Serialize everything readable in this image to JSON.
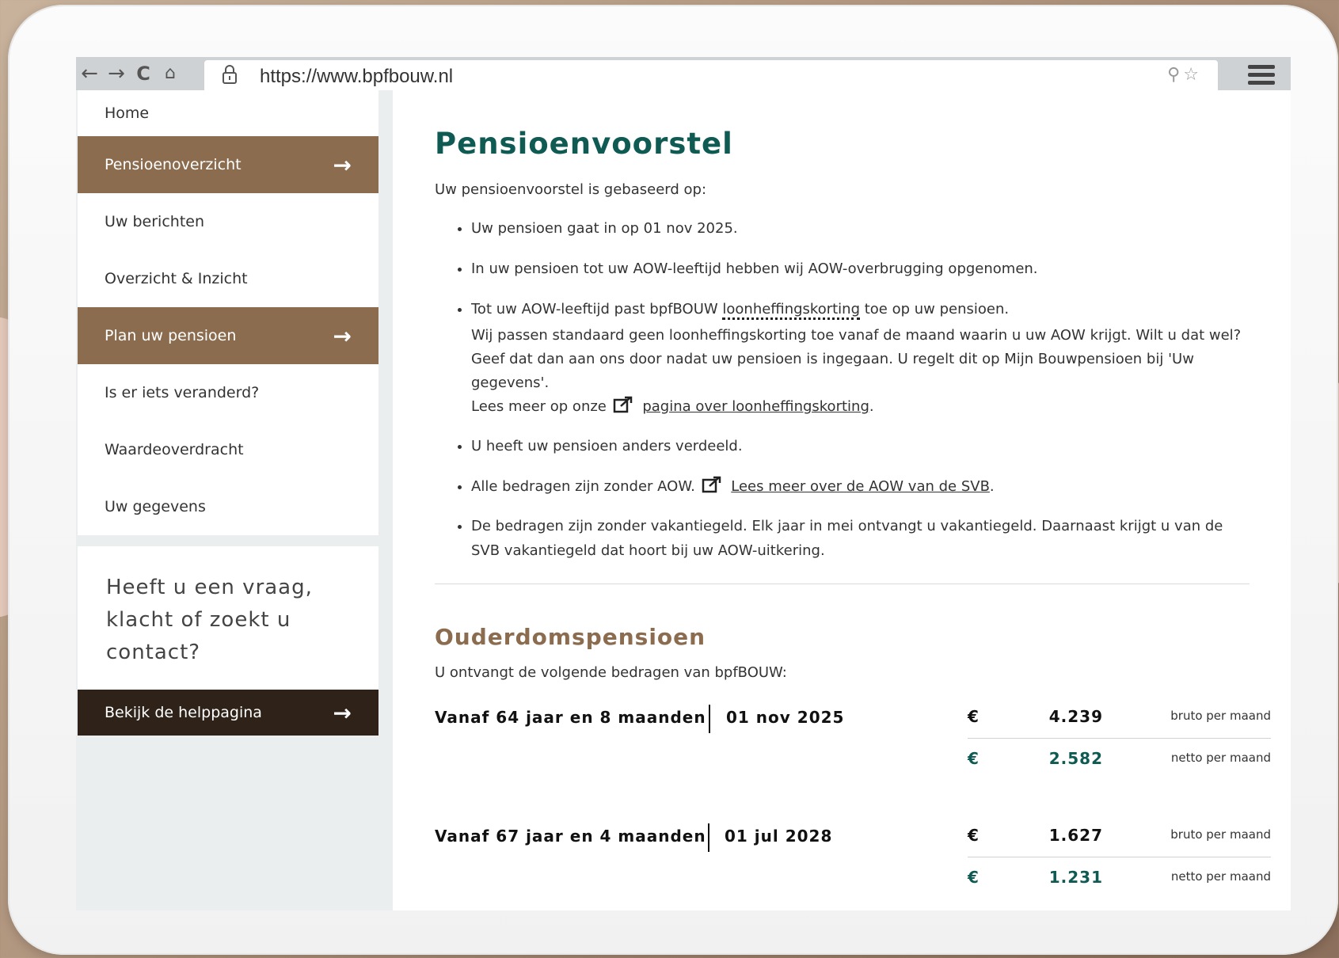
{
  "browser": {
    "url": "https://www.bpfbouw.nl"
  },
  "sidebar": {
    "items": [
      {
        "label": "Home"
      },
      {
        "label": "Pensioenoverzicht"
      },
      {
        "label": "Uw berichten"
      },
      {
        "label": "Overzicht & Inzicht"
      },
      {
        "label": "Plan uw pensioen"
      },
      {
        "label": "Is er iets veranderd?"
      },
      {
        "label": "Waardeoverdracht"
      },
      {
        "label": "Uw gegevens"
      }
    ],
    "help_text": "Heeft u een vraag, klacht of zoekt u contact?",
    "help_button": "Bekijk de helppagina"
  },
  "main": {
    "title": "Pensioenvoorstel",
    "intro": "Uw pensioenvoorstel is gebaseerd op:",
    "bullet1": "Uw pensioen gaat in op 01 nov 2025.",
    "bullet2": "In uw pensioen tot uw AOW-leeftijd hebben wij AOW-overbrugging opgenomen.",
    "bullet3_a": "Tot uw AOW-leeftijd past bpfBOUW ",
    "bullet3_term": "loonheffingskorting",
    "bullet3_b": " toe op uw pensioen.",
    "bullet3_para": "Wij passen standaard geen loonheffingskorting toe vanaf de maand waarin u uw AOW krijgt. Wilt u dat wel? Geef dat dan aan ons door nadat uw pensioen is ingegaan. U regelt dit op Mijn Bouwpensioen bij 'Uw gegevens'.",
    "bullet3_read": "Lees meer op onze",
    "bullet3_link": "pagina over loonheffingskorting",
    "bullet4": "U heeft uw pensioen anders verdeeld.",
    "bullet5_a": "Alle bedragen zijn zonder AOW.",
    "bullet5_link": "Lees meer over de AOW van de SVB",
    "bullet6": "De bedragen zijn zonder vakantiegeld. Elk jaar in mei ontvangt u vakantiegeld. Daarnaast krijgt u van de SVB vakantiegeld dat hoort bij uw AOW-uitkering.",
    "section_title": "Ouderdomspensioen",
    "section_intro": "U ontvangt de volgende bedragen van bpfBOUW:"
  },
  "amounts": [
    {
      "period": "Vanaf 64 jaar en 8 maanden",
      "date": "01 nov 2025",
      "currency": "€",
      "gross": "4.239",
      "gross_label": "bruto per maand",
      "net": "2.582",
      "net_label": "netto per maand"
    },
    {
      "period": "Vanaf 67 jaar en 4 maanden",
      "date": "01 jul 2028",
      "currency": "€",
      "gross": "1.627",
      "gross_label": "bruto per maand",
      "net": "1.231",
      "net_label": "netto per maand"
    }
  ],
  "colors": {
    "brand_brown": "#8b6c4f",
    "brand_teal": "#0f5a52",
    "dark_button": "#2e2219"
  }
}
